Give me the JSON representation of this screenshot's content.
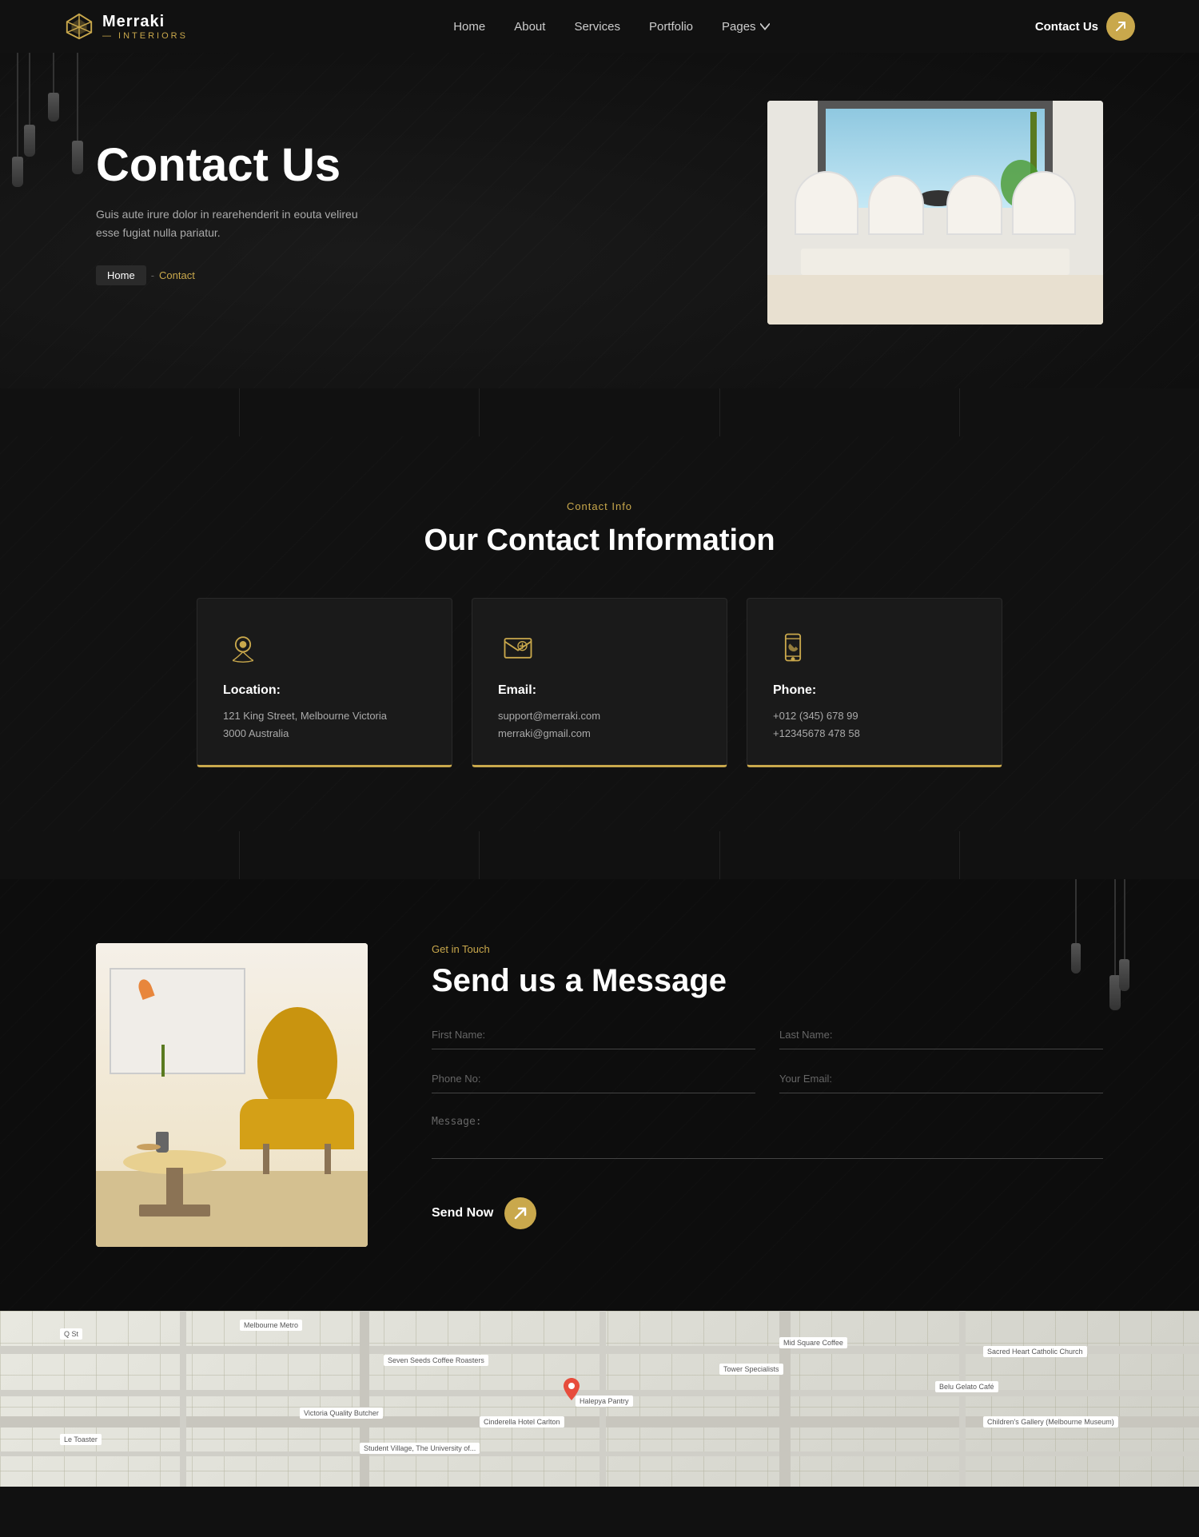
{
  "brand": {
    "name": "Merraki",
    "sub": "— Interiors"
  },
  "nav": {
    "home": "Home",
    "about": "About",
    "services": "Services",
    "portfolio": "Portfolio",
    "pages": "Pages",
    "contact_label": "Contact Us"
  },
  "hero": {
    "title": "Contact Us",
    "description": "Guis aute irure dolor in rearehenderit in eouta velireu esse fugiat nulla pariatur.",
    "breadcrumb_home": "Home",
    "breadcrumb_sep": "-",
    "breadcrumb_current": "Contact"
  },
  "contact_info": {
    "section_label": "Contact Info",
    "section_title": "Our Contact Information",
    "cards": [
      {
        "icon": "location",
        "title": "Location:",
        "lines": [
          "121 King Street, Melbourne Victoria",
          "3000 Australia"
        ]
      },
      {
        "icon": "email",
        "title": "Email:",
        "lines": [
          "support@merraki.com",
          "merraki@gmail.com"
        ]
      },
      {
        "icon": "phone",
        "title": "Phone:",
        "lines": [
          "+012 (345) 678 99",
          "+12345678 478 58"
        ]
      }
    ]
  },
  "form": {
    "section_label": "Get in Touch",
    "section_title": "Send us a Message",
    "fields": {
      "first_name": "First Name:",
      "last_name": "Last Name:",
      "phone": "Phone No:",
      "email": "Your Email:",
      "message": "Message:"
    },
    "send_label": "Send Now"
  }
}
